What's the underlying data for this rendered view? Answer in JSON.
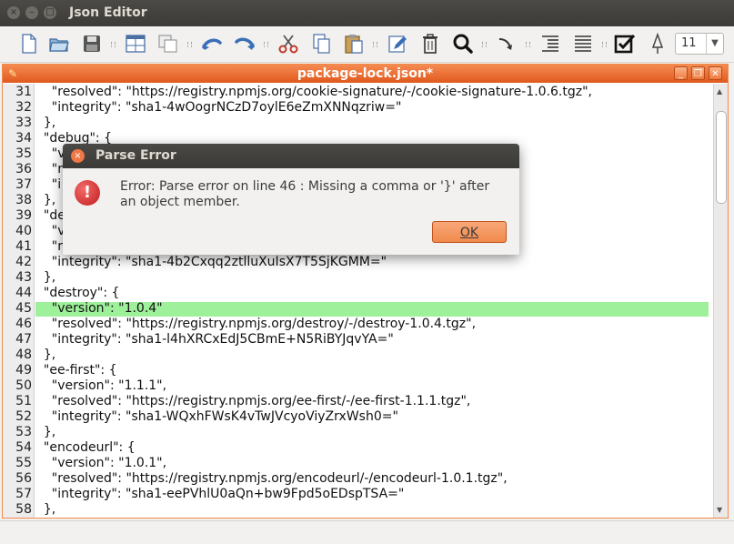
{
  "window": {
    "title": "Json Editor",
    "controls": [
      "close-icon",
      "minimize-icon",
      "maximize-icon"
    ]
  },
  "toolbar": {
    "buttons": [
      {
        "name": "new-file",
        "icon": "new-file-icon"
      },
      {
        "name": "open-file",
        "icon": "folder-open-icon"
      },
      {
        "name": "save",
        "icon": "save-icon"
      },
      {
        "name": "tile-windows",
        "icon": "tile-icon"
      },
      {
        "name": "cascade-windows",
        "icon": "cascade-icon"
      },
      {
        "name": "undo",
        "icon": "undo-icon"
      },
      {
        "name": "redo",
        "icon": "redo-icon"
      },
      {
        "name": "cut",
        "icon": "scissors-icon"
      },
      {
        "name": "copy",
        "icon": "copy-icon"
      },
      {
        "name": "paste",
        "icon": "paste-icon"
      },
      {
        "name": "edit",
        "icon": "pencil-icon"
      },
      {
        "name": "delete",
        "icon": "trash-icon"
      },
      {
        "name": "search",
        "icon": "search-icon"
      },
      {
        "name": "goto",
        "icon": "goto-icon"
      },
      {
        "name": "indent",
        "icon": "indent-icon"
      },
      {
        "name": "align",
        "icon": "align-icon"
      },
      {
        "name": "validate",
        "icon": "checkbox-icon"
      },
      {
        "name": "pin",
        "icon": "pin-icon"
      }
    ],
    "font_size": "11"
  },
  "document": {
    "title": "package-lock.json*",
    "highlight_line": 45,
    "lines": [
      {
        "n": "31",
        "text": "    \"resolved\": \"https://registry.npmjs.org/cookie-signature/-/cookie-signature-1.0.6.tgz\","
      },
      {
        "n": "32",
        "text": "    \"integrity\": \"sha1-4wOogrNCzD7oylE6eZmXNNqzriw=\""
      },
      {
        "n": "33",
        "text": "  },"
      },
      {
        "n": "34",
        "text": "  \"debug\": {"
      },
      {
        "n": "35",
        "text": "    \"v"
      },
      {
        "n": "36",
        "text": "    \"r"
      },
      {
        "n": "37",
        "text": "    \"i"
      },
      {
        "n": "38",
        "text": "  },"
      },
      {
        "n": "39",
        "text": "  \"de"
      },
      {
        "n": "40",
        "text": "    \"v"
      },
      {
        "n": "41",
        "text": "    \"r"
      },
      {
        "n": "42",
        "text": "    \"integrity\": \"sha1-4b2Cxqq2ztlluXuIsX7T5SjKGMM=\""
      },
      {
        "n": "43",
        "text": "  },"
      },
      {
        "n": "44",
        "text": "  \"destroy\": {"
      },
      {
        "n": "45",
        "text": "    \"version\": \"1.0.4\""
      },
      {
        "n": "46",
        "text": "    \"resolved\": \"https://registry.npmjs.org/destroy/-/destroy-1.0.4.tgz\","
      },
      {
        "n": "47",
        "text": "    \"integrity\": \"sha1-l4hXRCxEdJ5CBmE+N5RiBYJqvYA=\""
      },
      {
        "n": "48",
        "text": "  },"
      },
      {
        "n": "49",
        "text": "  \"ee-first\": {"
      },
      {
        "n": "50",
        "text": "    \"version\": \"1.1.1\","
      },
      {
        "n": "51",
        "text": "    \"resolved\": \"https://registry.npmjs.org/ee-first/-/ee-first-1.1.1.tgz\","
      },
      {
        "n": "52",
        "text": "    \"integrity\": \"sha1-WQxhFWsK4vTwJVcyoViyZrxWsh0=\""
      },
      {
        "n": "53",
        "text": "  },"
      },
      {
        "n": "54",
        "text": "  \"encodeurl\": {"
      },
      {
        "n": "55",
        "text": "    \"version\": \"1.0.1\","
      },
      {
        "n": "56",
        "text": "    \"resolved\": \"https://registry.npmjs.org/encodeurl/-/encodeurl-1.0.1.tgz\","
      },
      {
        "n": "57",
        "text": "    \"integrity\": \"sha1-eePVhlU0aQn+bw9Fpd5oEDspTSA=\""
      },
      {
        "n": "58",
        "text": "  },"
      }
    ]
  },
  "dialog": {
    "title": "Parse Error",
    "message": "Error: Parse error on line 46 : Missing a comma or '}' after an object member.",
    "ok_label": "OK",
    "icon": "error-icon"
  },
  "colors": {
    "accent": "#f08a4b",
    "highlight": "#9ef09b",
    "titlebar": "#3c3b37"
  }
}
